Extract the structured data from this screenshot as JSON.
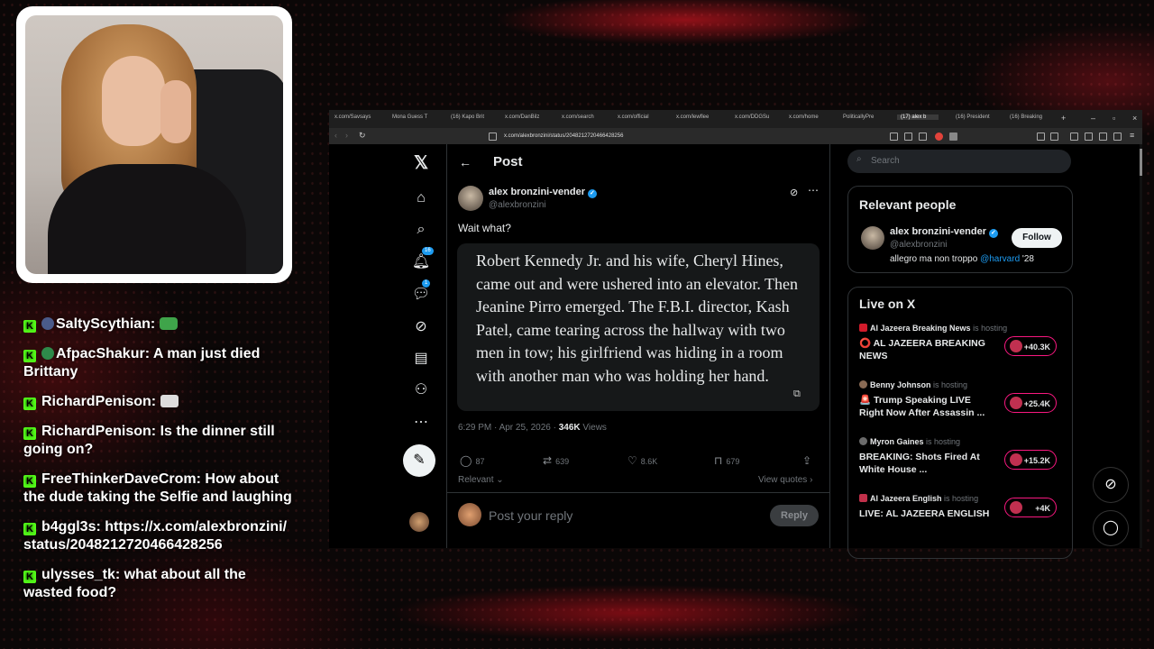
{
  "chat": [
    {
      "user": "SaltyScythian:",
      "text": ""
    },
    {
      "user": "AfpacShakur:",
      "text": "A man just died Brittany"
    },
    {
      "user": "RichardPenison:",
      "text": ""
    },
    {
      "user": "RichardPenison:",
      "text": "Is the dinner still going on?"
    },
    {
      "user": "FreeThinkerDaveCrom:",
      "text": "How about the dude taking the Selfie and laughing"
    },
    {
      "user": "b4ggl3s:",
      "text": "https://x.com/alexbronzini/status/2048212720466428256"
    },
    {
      "user": "ulysses_tk:",
      "text": "what about all the wasted food?"
    }
  ],
  "browser": {
    "tabs": [
      "x.com/Savsays",
      "Mona Guess T",
      "(16) Kapo Brit",
      "x.com/DanBilz",
      "x.com/search",
      "x.com/official",
      "x.com/lewflee",
      "x.com/DDGSu",
      "x.com/home",
      "PoliticallyPre",
      "(17) alex b",
      "(16) President",
      "(16) Breaking"
    ],
    "url": "x.com/alexbronzini/status/2048212720466428256"
  },
  "nav": {
    "notifications_badge": "16",
    "messages_badge": "1"
  },
  "post": {
    "header_title": "Post",
    "author_name": "alex bronzini-vender",
    "author_handle": "@alexbronzini",
    "text": "Wait what?",
    "quote": "Robert Kennedy Jr. and his wife, Cheryl Hines, came out and were ushered into an elevator. Then Jeanine Pirro emerged. The F.B.I. director, Kash Patel, came tearing across the hallway with two men in tow; his girlfriend was hiding in a room with another man who was holding her hand.",
    "time": "6:29 PM · Apr 25, 2026 · ",
    "views": "346K",
    "views_label": " Views",
    "replies": "87",
    "reposts": "639",
    "likes": "8.6K",
    "bookmarks": "679",
    "sort_label": "Relevant",
    "view_quotes": "View quotes",
    "reply_placeholder": "Post your reply",
    "reply_button": "Reply"
  },
  "sidebar": {
    "search_placeholder": "Search",
    "relevant_title": "Relevant people",
    "person_name": "alex bronzini-vender",
    "person_handle": "@alexbronzini",
    "person_bio": "allegro ma non troppo ",
    "person_bio_link": "@harvard",
    "person_bio_tail": " '28",
    "follow_label": "Follow",
    "live_title": "Live on X",
    "live": [
      {
        "host": "Al Jazeera Breaking News",
        "suffix": " is hosting",
        "title": "⭕ AL JAZEERA BREAKING NEWS",
        "count": "+40.3K",
        "color": "#d11b2b"
      },
      {
        "host": "Benny Johnson",
        "suffix": " is hosting",
        "title": "🚨 Trump Speaking LIVE Right Now After Assassin ...",
        "count": "+25.4K",
        "color": "#8a6b55"
      },
      {
        "host": "Myron Gaines",
        "suffix": " is hosting",
        "title": "BREAKING: Shots Fired At White House ...",
        "count": "+15.2K",
        "color": "#6b6b6b"
      },
      {
        "host": "Al Jazeera English",
        "suffix": " is hosting",
        "title": "LIVE: AL JAZEERA ENGLISH",
        "count": "+4K",
        "color": "#c0304a"
      }
    ]
  }
}
